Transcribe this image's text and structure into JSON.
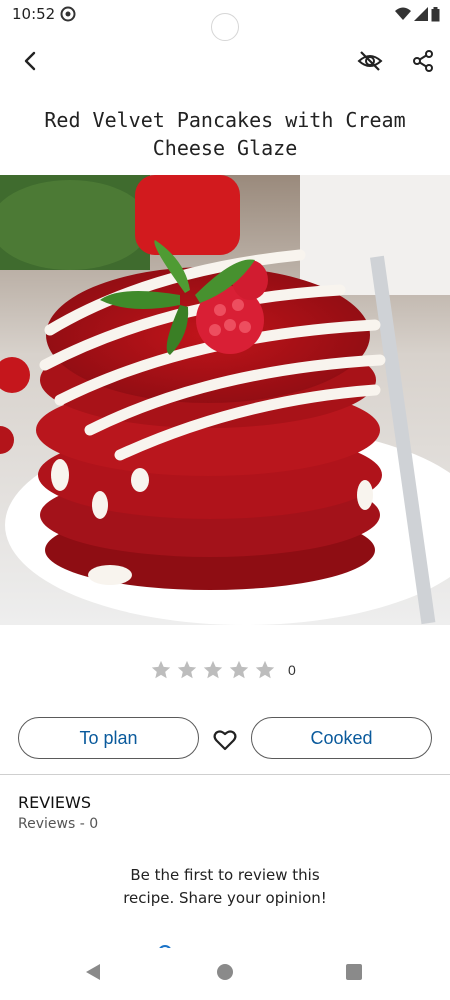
{
  "status": {
    "time": "10:52"
  },
  "toolbar": {
    "back_icon": "arrow-back-icon",
    "hide_icon": "eye-off-icon",
    "share_icon": "share-icon"
  },
  "recipe": {
    "title": "Red Velvet Pancakes with Cream Cheese Glaze",
    "image": "red velvet pancake stack with cream cheese glaze, raspberries and mint",
    "rating": {
      "stars_filled": 0,
      "stars_total": 5,
      "count": "0"
    }
  },
  "actions": {
    "plan_label": "To plan",
    "cooked_label": "Cooked",
    "favorite_icon": "heart-outline-icon"
  },
  "reviews": {
    "heading": "REVIEWS",
    "count_text": "Reviews - 0",
    "empty_line1": "Be the first to review this",
    "empty_line2": "recipe. Share your opinion!"
  },
  "colors": {
    "accent": "#0a5a9c",
    "star_empty": "#bdbdbd",
    "border": "#5a5a5a"
  }
}
